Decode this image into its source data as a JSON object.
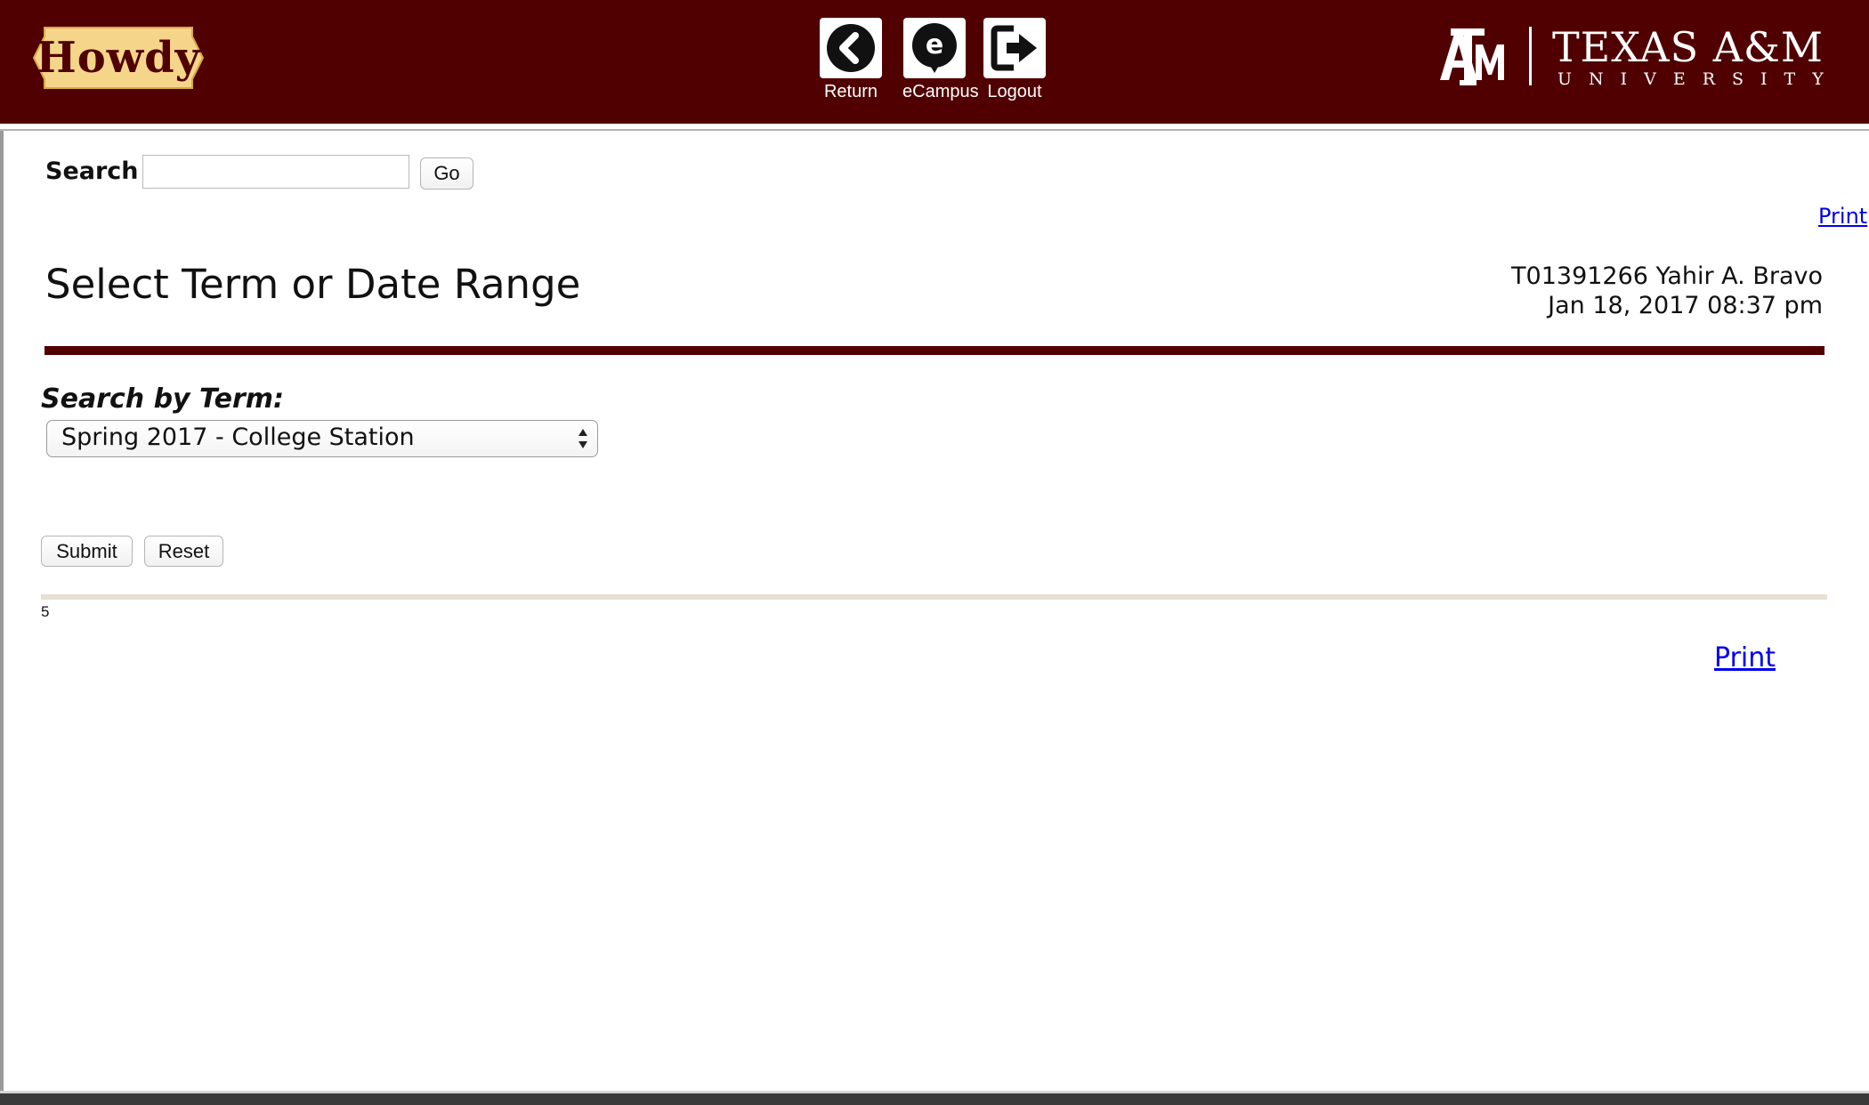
{
  "header": {
    "logo_text": "Howdy",
    "nav": [
      {
        "label": "Return",
        "icon": "return-icon"
      },
      {
        "label": "eCampus",
        "icon": "ecampus-icon"
      },
      {
        "label": "Logout",
        "icon": "logout-icon"
      }
    ],
    "university": {
      "name": "TEXAS A&M",
      "subtitle": "UNIVERSITY",
      "monogram": "ATM"
    }
  },
  "search": {
    "label": "Search",
    "value": "",
    "go_label": "Go"
  },
  "print_label": "Print",
  "main": {
    "title": "Select Term or Date Range",
    "user_line": "T01391266 Yahir A. Bravo",
    "datetime": "Jan 18, 2017 08:37 pm",
    "term_label": "Search by Term:",
    "term_selected": "Spring 2017 - College Station",
    "submit_label": "Submit",
    "reset_label": "Reset",
    "footnote": "5"
  },
  "colors": {
    "maroon": "#500000",
    "link": "#0000ee",
    "logo_gold": "#f5d58a",
    "rule_tan": "#e8e1d3"
  }
}
